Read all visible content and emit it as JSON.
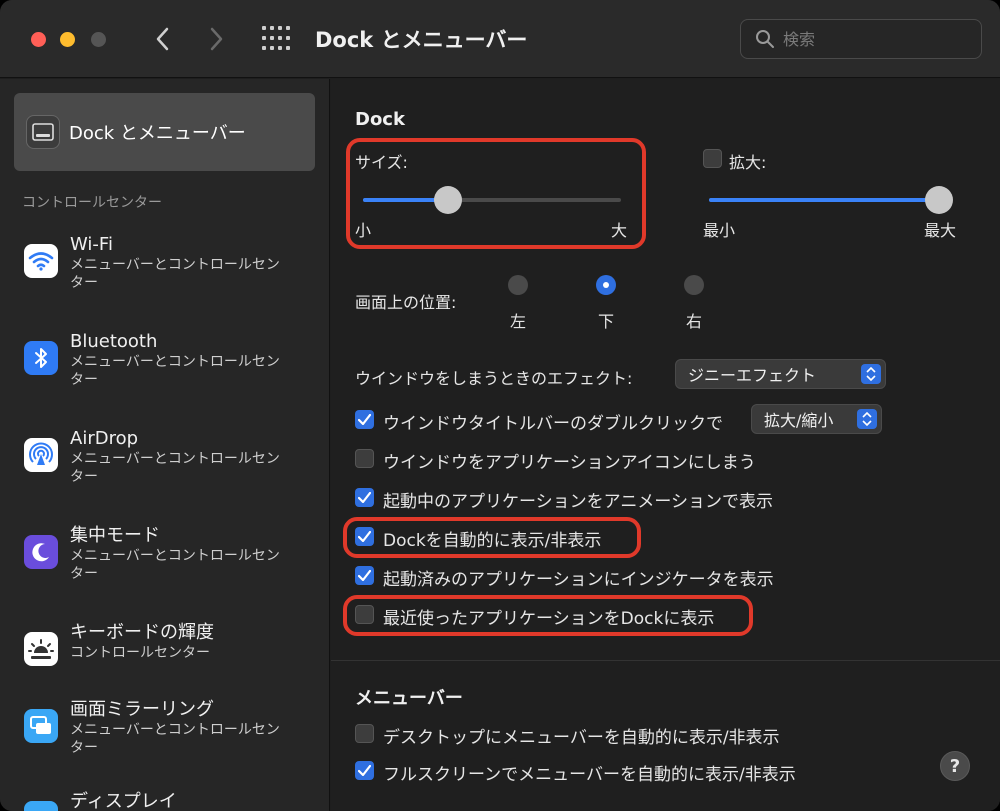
{
  "window": {
    "title": "Dock とメニューバー",
    "search_placeholder": "検索"
  },
  "sidebar": {
    "selected": {
      "label": "Dock とメニューバー",
      "icon": "dock-icon"
    },
    "section_header": "コントロールセンター",
    "items": [
      {
        "name": "Wi-Fi",
        "sub": "メニューバーとコントロールセンター",
        "icon": "wifi-icon",
        "color": "#ffffff"
      },
      {
        "name": "Bluetooth",
        "sub": "メニューバーとコントロールセンター",
        "icon": "bluetooth-icon",
        "color": "#2f7bf5"
      },
      {
        "name": "AirDrop",
        "sub": "メニューバーとコントロールセンター",
        "icon": "airdrop-icon",
        "color": "#ffffff"
      },
      {
        "name": "集中モード",
        "sub": "メニューバーとコントロールセンター",
        "icon": "moon-icon",
        "color": "#6a4ddc"
      },
      {
        "name": "キーボードの輝度",
        "sub": "コントロールセンター",
        "icon": "keyboard-brightness-icon",
        "color": "#ffffff"
      },
      {
        "name": "画面ミラーリング",
        "sub": "メニューバーとコントロールセンター",
        "icon": "screen-mirroring-icon",
        "color": "#3aa7f5"
      },
      {
        "name": "ディスプレイ",
        "sub": "",
        "icon": "display-icon",
        "color": "#3aa7f5"
      }
    ]
  },
  "dock": {
    "heading": "Dock",
    "size": {
      "label": "サイズ:",
      "min_label": "小",
      "max_label": "大",
      "value": 0.33
    },
    "magnification": {
      "label": "拡大:",
      "checked": false,
      "min_label": "最小",
      "max_label": "最大",
      "value": 1.0
    },
    "position": {
      "label": "画面上の位置:",
      "options": [
        "左",
        "下",
        "右"
      ],
      "selected": "下"
    },
    "minimize_effect": {
      "label": "ウインドウをしまうときのエフェクト:",
      "value": "ジニーエフェクト"
    },
    "double_click": {
      "label": "ウインドウタイトルバーのダブルクリックで",
      "checked": true,
      "value": "拡大/縮小"
    },
    "options": [
      {
        "label": "ウインドウをアプリケーションアイコンにしまう",
        "checked": false
      },
      {
        "label": "起動中のアプリケーションをアニメーションで表示",
        "checked": true
      },
      {
        "label": "Dockを自動的に表示/非表示",
        "checked": true
      },
      {
        "label": "起動済みのアプリケーションにインジケータを表示",
        "checked": true
      },
      {
        "label": "最近使ったアプリケーションをDockに表示",
        "checked": false
      }
    ]
  },
  "menubar": {
    "heading": "メニューバー",
    "options": [
      {
        "label": "デスクトップにメニューバーを自動的に表示/非表示",
        "checked": false
      },
      {
        "label": "フルスクリーンでメニューバーを自動的に表示/非表示",
        "checked": true
      }
    ]
  },
  "help_label": "?",
  "colors": {
    "accent": "#2f6fe0",
    "highlight": "#e0392a"
  }
}
